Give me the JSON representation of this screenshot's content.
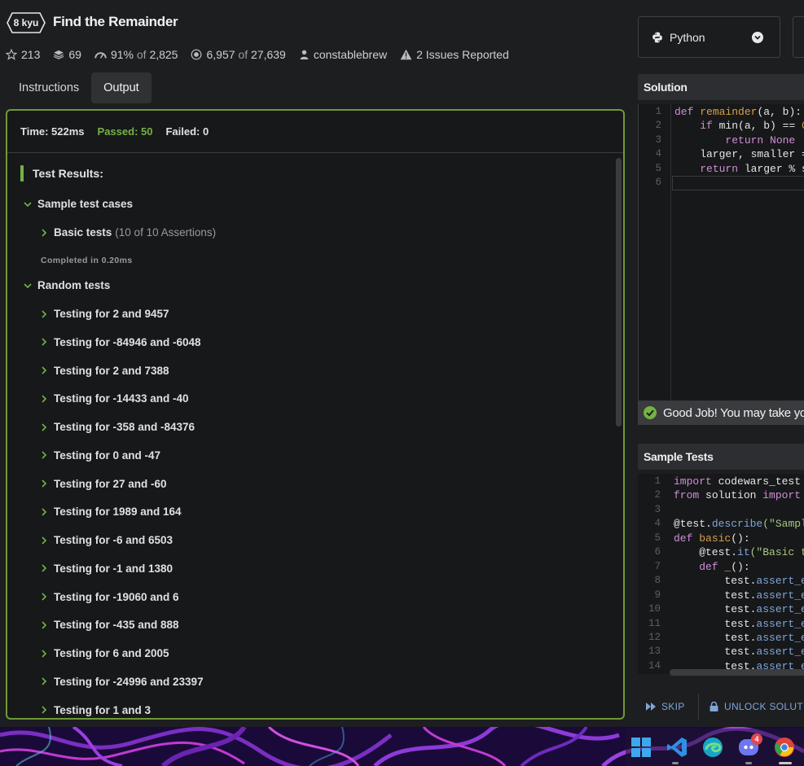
{
  "kata": {
    "rank": "8 kyu",
    "title": "Find the Remainder",
    "stats": {
      "stars": "213",
      "collections": "69",
      "satisfaction_pct": "91%",
      "satisfaction_of": "of",
      "satisfaction_votes": "2,825",
      "completed": "6,957",
      "completed_of": "of",
      "attempted": "27,639",
      "author": "constablebrew",
      "issues": "2 Issues Reported"
    }
  },
  "tabs": [
    {
      "label": "Instructions",
      "active": false
    },
    {
      "label": "Output",
      "active": true
    }
  ],
  "output": {
    "time": "Time: 522ms",
    "passed": "Passed: 50",
    "failed": "Failed: 0",
    "results_title": "Test Results:",
    "sample_group": "Sample test cases",
    "basic_tests": "Basic tests",
    "basic_assertions": "(10 of 10 Assertions)",
    "completed_in": "Completed in 0.20ms",
    "random_group": "Random tests",
    "random_tests": [
      "Testing for 2 and 9457",
      "Testing for -84946 and -6048",
      "Testing for 2 and 7388",
      "Testing for -14433 and -40",
      "Testing for -358 and -84376",
      "Testing for 0 and -47",
      "Testing for 27 and -60",
      "Testing for 1989 and 164",
      "Testing for -6 and 6503",
      "Testing for -1 and 1380",
      "Testing for -19060 and 6",
      "Testing for -435 and 888",
      "Testing for 6 and 2005",
      "Testing for -24996 and 23397",
      "Testing for 1 and 3"
    ]
  },
  "language": {
    "selected": "Python"
  },
  "solution": {
    "header": "Solution",
    "line_numbers": [
      "1",
      "2",
      "3",
      "4",
      "5",
      "6"
    ],
    "code": {
      "l1_kw": "def ",
      "l1_fn": "remainder",
      "l1_rest": "(a, b):",
      "l2_indent": "    ",
      "l2_kw": "if ",
      "l2_rest": "min(a, b) == ",
      "l2_num": "0",
      "l3_indent": "        ",
      "l3_kw": "return ",
      "l3_val": "None",
      "l4": "    larger, smaller =",
      "l5_indent": "    ",
      "l5_kw": "return ",
      "l5_rest": "larger % s"
    }
  },
  "status_message": "Good Job! You may take yo",
  "sample_tests": {
    "header": "Sample Tests",
    "line_numbers": [
      "1",
      "2",
      "3",
      "4",
      "5",
      "6",
      "7",
      "8",
      "9",
      "10",
      "11",
      "12",
      "13",
      "14"
    ],
    "code": {
      "l1_kw": "import ",
      "l1_rest": "codewars_test",
      "l2_kw": "from ",
      "l2_mid": "solution ",
      "l2_kw2": "import",
      "l4_dec": "@test.",
      "l4_attr": "describe",
      "l4_str": "(\"Sampl",
      "l5_kw": "def ",
      "l5_fn": "basic",
      "l5_rest": "():",
      "l6_dec": "    @test.",
      "l6_attr": "it",
      "l6_str": "(\"Basic t",
      "l7_kw": "    def ",
      "l7_fn": "_",
      "l7_rest": "():",
      "assert_prefix": "        test.",
      "assert_attr": "assert_e"
    }
  },
  "actions": {
    "skip": "SKIP",
    "unlock": "UNLOCK SOLUTI"
  },
  "taskbar": {
    "discord_badge": "4"
  },
  "colors": {
    "accent_green": "#74b244",
    "panel_border": "#6f9a36",
    "link_blue": "#7fa6d9"
  }
}
